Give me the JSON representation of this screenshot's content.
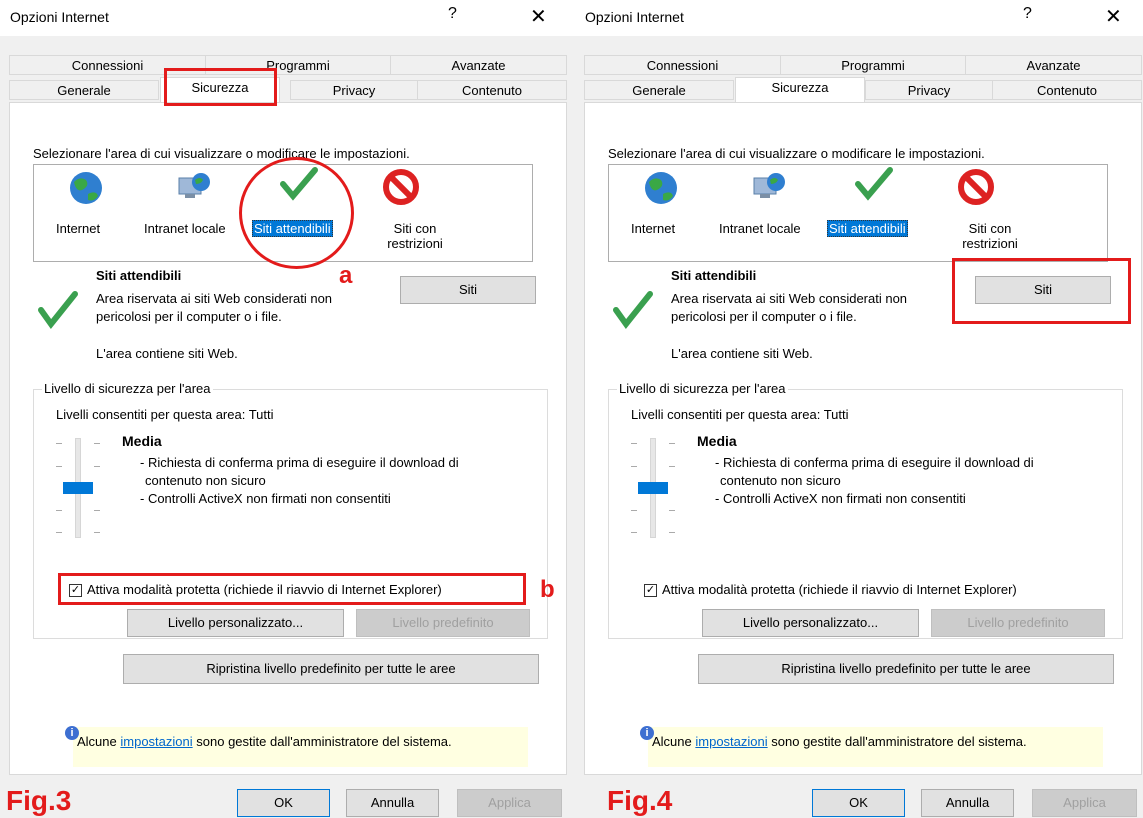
{
  "dialogs": [
    {
      "title": "Opzioni Internet",
      "help_glyph": "?",
      "close_glyph": "✕",
      "tabs_row1": [
        "Connessioni",
        "Programmi",
        "Avanzate"
      ],
      "tabs_row2": [
        "Generale",
        "Sicurezza",
        "Privacy",
        "Contenuto"
      ],
      "active_tab": "Sicurezza",
      "zone_prompt": "Selezionare l'area di cui visualizzare o modificare le impostazioni.",
      "zones": [
        {
          "label": "Internet",
          "icon": "globe-icon"
        },
        {
          "label": "Intranet locale",
          "icon": "intranet-icon"
        },
        {
          "label": "Siti attendibili",
          "icon": "checkmark-icon",
          "selected": true
        },
        {
          "label": "Siti con restrizioni",
          "icon": "prohibited-icon"
        }
      ],
      "zone_title": "Siti attendibili",
      "zone_desc1": "Area riservata ai siti Web considerati non",
      "zone_desc2": "pericolosi per il computer o i file.",
      "zone_contains": "L'area contiene siti Web.",
      "siti_button": "Siti",
      "security_group": "Livello di sicurezza per l'area",
      "allowed_levels": "Livelli consentiti per questa area: Tutti",
      "level_name": "Media",
      "level_desc1": "- Richiesta di conferma prima di eseguire il download di",
      "level_desc2": "contenuto non sicuro",
      "level_desc3": "- Controlli ActiveX non firmati non consentiti",
      "protected_mode": "Attiva modalità protetta (richiede il riavvio di Internet Explorer)",
      "protected_mode_checked": true,
      "custom_level_button": "Livello personalizzato...",
      "default_level_button": "Livello predefinito",
      "reset_all_button": "Ripristina livello predefinito per tutte le aree",
      "info_prefix": "Alcune",
      "info_link": "impostazioni",
      "info_suffix": "sono gestite dall'amministratore del sistema.",
      "ok_button": "OK",
      "cancel_button": "Annulla",
      "apply_button": "Applica",
      "fig_label": "Fig.3",
      "annotation_a": "a",
      "annotation_b": "b"
    },
    {
      "title": "Opzioni Internet",
      "help_glyph": "?",
      "close_glyph": "✕",
      "tabs_row1": [
        "Connessioni",
        "Programmi",
        "Avanzate"
      ],
      "tabs_row2": [
        "Generale",
        "Sicurezza",
        "Privacy",
        "Contenuto"
      ],
      "active_tab": "Sicurezza",
      "zone_prompt": "Selezionare l'area di cui visualizzare o modificare le impostazioni.",
      "zones": [
        {
          "label": "Internet",
          "icon": "globe-icon"
        },
        {
          "label": "Intranet locale",
          "icon": "intranet-icon"
        },
        {
          "label": "Siti attendibili",
          "icon": "checkmark-icon",
          "selected": true
        },
        {
          "label": "Siti con restrizioni",
          "icon": "prohibited-icon"
        }
      ],
      "zone_title": "Siti attendibili",
      "zone_desc1": "Area riservata ai siti Web considerati non",
      "zone_desc2": "pericolosi per il computer o i file.",
      "zone_contains": "L'area contiene siti Web.",
      "siti_button": "Siti",
      "security_group": "Livello di sicurezza per l'area",
      "allowed_levels": "Livelli consentiti per questa area: Tutti",
      "level_name": "Media",
      "level_desc1": "- Richiesta di conferma prima di eseguire il download di",
      "level_desc2": "contenuto non sicuro",
      "level_desc3": "- Controlli ActiveX non firmati non consentiti",
      "protected_mode": "Attiva modalità protetta (richiede il riavvio di Internet Explorer)",
      "protected_mode_checked": true,
      "custom_level_button": "Livello personalizzato...",
      "default_level_button": "Livello predefinito",
      "reset_all_button": "Ripristina livello predefinito per tutte le aree",
      "info_prefix": "Alcune",
      "info_link": "impostazioni",
      "info_suffix": "sono gestite dall'amministratore del sistema.",
      "ok_button": "OK",
      "cancel_button": "Annulla",
      "apply_button": "Applica",
      "fig_label": "Fig.4"
    }
  ],
  "colors": {
    "annotation": "#e31b1b",
    "selection": "#0078d7",
    "info_bar": "#ffffe1"
  }
}
